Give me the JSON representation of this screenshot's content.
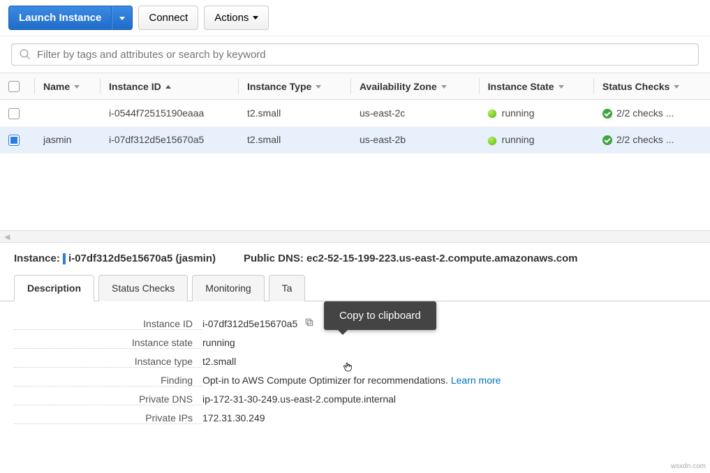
{
  "toolbar": {
    "launch_label": "Launch Instance",
    "connect_label": "Connect",
    "actions_label": "Actions"
  },
  "filter": {
    "placeholder": "Filter by tags and attributes or search by keyword"
  },
  "columns": {
    "name": "Name",
    "instance_id": "Instance ID",
    "instance_type": "Instance Type",
    "az": "Availability Zone",
    "state": "Instance State",
    "checks": "Status Checks"
  },
  "rows": [
    {
      "selected": false,
      "name": "",
      "id": "i-0544f72515190eaaa",
      "type": "t2.small",
      "az": "us-east-2c",
      "state": "running",
      "checks": "2/2 checks ..."
    },
    {
      "selected": true,
      "name": "jasmin",
      "id": "i-07df312d5e15670a5",
      "type": "t2.small",
      "az": "us-east-2b",
      "state": "running",
      "checks": "2/2 checks ..."
    }
  ],
  "details_header": {
    "instance_label": "Instance:",
    "instance_value": "i-07df312d5e15670a5 (jasmin)",
    "dns_label": "Public DNS:",
    "dns_value": "ec2-52-15-199-223.us-east-2.compute.amazonaws.com"
  },
  "tabs": {
    "description": "Description",
    "status_checks": "Status Checks",
    "monitoring": "Monitoring",
    "tags": "Ta"
  },
  "description": {
    "instance_id_label": "Instance ID",
    "instance_id_value": "i-07df312d5e15670a5",
    "state_label": "Instance state",
    "state_value": "running",
    "type_label": "Instance type",
    "type_value": "t2.small",
    "finding_label": "Finding",
    "finding_value": "Opt-in to AWS Compute Optimizer for recommendations.",
    "finding_link": "Learn more",
    "priv_dns_label": "Private DNS",
    "priv_dns_value": "ip-172-31-30-249.us-east-2.compute.internal",
    "priv_ips_label": "Private IPs",
    "priv_ips_value": "172.31.30.249"
  },
  "tooltip": "Copy to clipboard",
  "watermark": "wsxdn.com"
}
